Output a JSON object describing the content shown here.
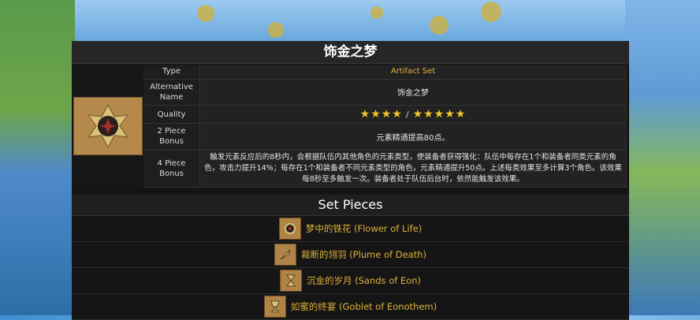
{
  "title": "饰金之梦",
  "properties": {
    "type_label": "Type",
    "type_value": "Artifact Set",
    "altname_label": "Alternative Name",
    "altname_value": "饰金之梦",
    "quality_label": "Quality",
    "quality_low": "★★★★",
    "quality_separator": "/",
    "quality_high": "★★★★★",
    "bonus2_label": "2 Piece Bonus",
    "bonus2_value": "元素精通提高80点。",
    "bonus4_label": "4 Piece Bonus",
    "bonus4_value": "触发元素反应后的8秒内，会根据队伍内其他角色的元素类型，使装备者获得强化：队伍中每存在1个和装备者同类元素的角色，攻击力提升14%；每存在1个和装备者不同元素类型的角色，元素精通提升50点。上述每类效果至多计算3个角色。该效果每8秒至多触发一次。装备者处于队伍后台时，依然能触发该效果。"
  },
  "set_pieces": {
    "heading": "Set Pieces",
    "items": [
      {
        "label": "梦中的铁花 (Flower of Life)",
        "icon": "flower-icon"
      },
      {
        "label": "裁断的翎羽 (Plume of Death)",
        "icon": "plume-icon"
      },
      {
        "label": "沉金的岁月 (Sands of Eon)",
        "icon": "sands-icon"
      },
      {
        "label": "如蜜的终宴 (Goblet of Eonothem)",
        "icon": "goblet-icon"
      }
    ]
  },
  "colors": {
    "accent": "#e0b23a",
    "star": "#f2c52b",
    "panel": "#141414"
  }
}
